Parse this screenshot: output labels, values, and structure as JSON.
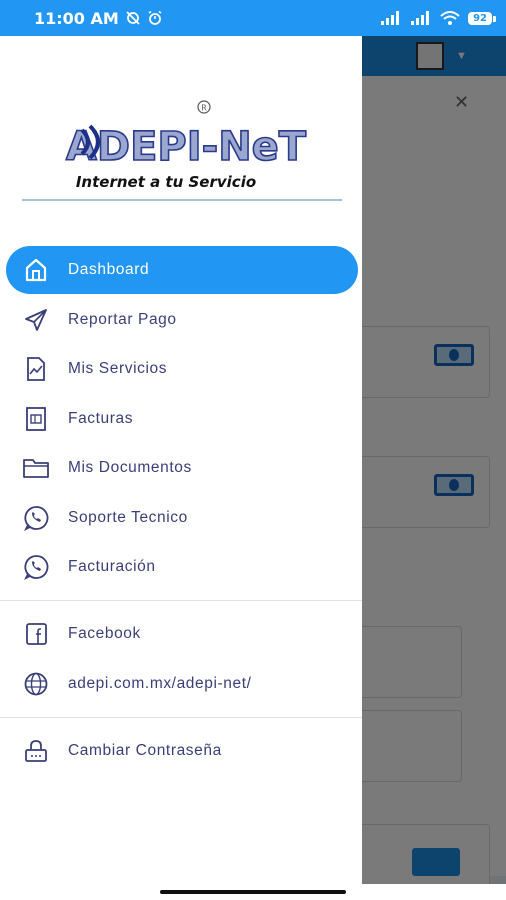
{
  "status_bar": {
    "time": "11:00 AM",
    "battery": "92"
  },
  "colors": {
    "accent": "#2196f3",
    "menu_text": "#3b3f78",
    "logo_dark": "#2b3a8c",
    "logo_light": "#9aa7cf"
  },
  "logo": {
    "brand_text": "ADEPI-NeT",
    "tagline": "Internet a tu Servicio",
    "registered": "R"
  },
  "menu": {
    "items": [
      {
        "label": "Dashboard",
        "icon": "home-icon"
      },
      {
        "label": "Reportar Pago",
        "icon": "send-icon"
      },
      {
        "label": "Mis Servicios",
        "icon": "chart-document-icon"
      },
      {
        "label": "Facturas",
        "icon": "invoice-icon"
      },
      {
        "label": "Mis Documentos",
        "icon": "folder-icon"
      },
      {
        "label": "Soporte Tecnico",
        "icon": "whatsapp-icon"
      },
      {
        "label": "Facturación",
        "icon": "whatsapp-icon"
      },
      {
        "label": "Facebook",
        "icon": "facebook-icon"
      },
      {
        "label": "adepi.com.mx/adepi-net/",
        "icon": "globe-icon"
      },
      {
        "label": "Cambiar Contraseña",
        "icon": "lock-icon"
      }
    ]
  }
}
